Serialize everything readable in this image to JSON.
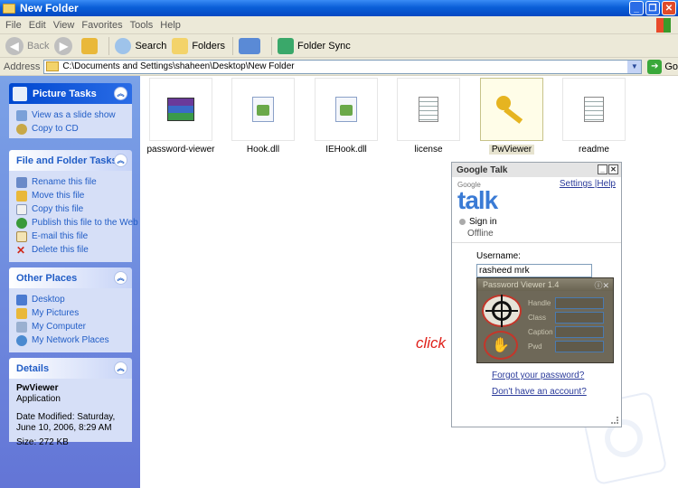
{
  "window": {
    "title": "New Folder"
  },
  "menu": [
    "File",
    "Edit",
    "View",
    "Favorites",
    "Tools",
    "Help"
  ],
  "toolbar": {
    "back": "Back",
    "search": "Search",
    "folders": "Folders",
    "folder_sync": "Folder Sync"
  },
  "address": {
    "label": "Address",
    "path": "C:\\Documents and Settings\\shaheen\\Desktop\\New Folder",
    "go": "Go"
  },
  "sidebar": {
    "picture_tasks": {
      "title": "Picture Tasks",
      "items": [
        "View as a slide show",
        "Copy to CD"
      ]
    },
    "file_tasks": {
      "title": "File and Folder Tasks",
      "items": [
        "Rename this file",
        "Move this file",
        "Copy this file",
        "Publish this file to the Web",
        "E-mail this file",
        "Delete this file"
      ]
    },
    "other_places": {
      "title": "Other Places",
      "items": [
        "Desktop",
        "My Pictures",
        "My Computer",
        "My Network Places"
      ]
    },
    "details": {
      "title": "Details",
      "name": "PwViewer",
      "type": "Application",
      "modified": "Date Modified: Saturday, June 10, 2006, 8:29 AM",
      "size": "Size: 272 KB"
    }
  },
  "files": [
    {
      "name": "password-viewer",
      "icon": "winrar-archive-icon"
    },
    {
      "name": "Hook.dll",
      "icon": "dll-file-icon"
    },
    {
      "name": "IEHook.dll",
      "icon": "dll-file-icon"
    },
    {
      "name": "license",
      "icon": "text-document-icon"
    },
    {
      "name": "PwViewer",
      "icon": "key-icon",
      "selected": true
    },
    {
      "name": "readme",
      "icon": "text-document-icon"
    }
  ],
  "gtalk": {
    "title": "Google Talk",
    "logo_small": "Google",
    "logo_big": "talk",
    "settings": "Settings",
    "help": "Help",
    "sign_in": "Sign in",
    "status": "Offline",
    "username_label": "Username:",
    "username_value": "rasheed mrk",
    "forgot": "Forgot your password?",
    "no_account": "Don't have an account?"
  },
  "pwviewer": {
    "title": "Password Viewer 1.4",
    "fields": [
      "Handle",
      "Class",
      "Caption",
      "Pwd"
    ]
  },
  "annotation": {
    "click": "click"
  }
}
